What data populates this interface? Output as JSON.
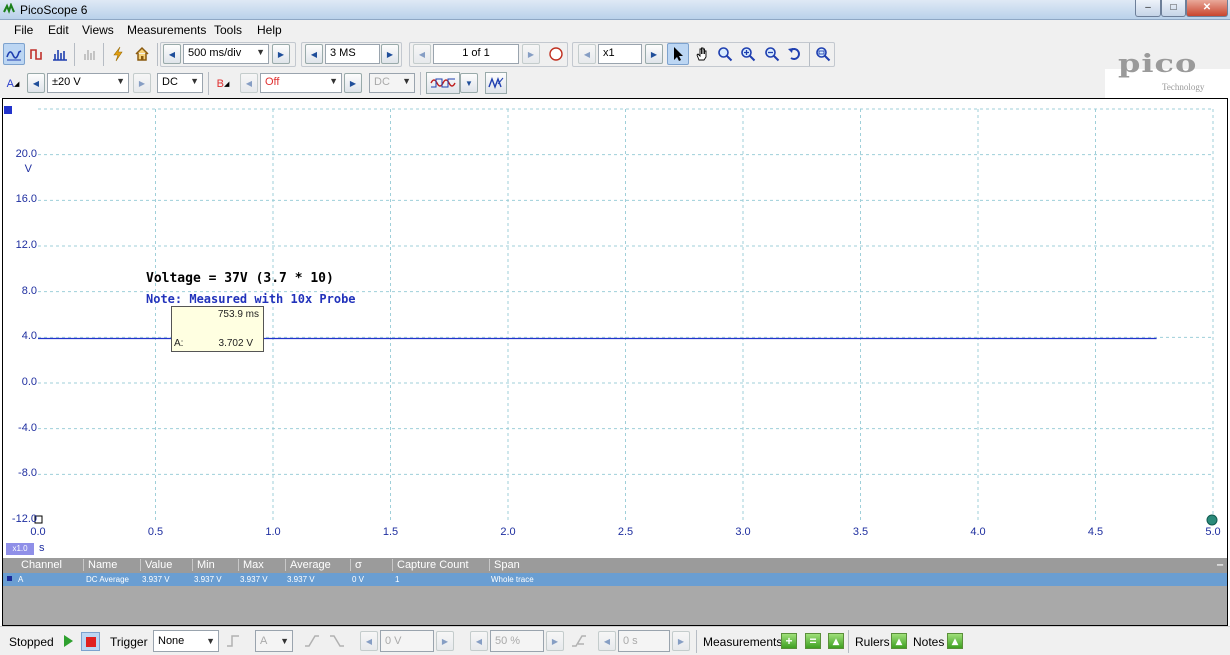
{
  "window": {
    "title": "PicoScope 6",
    "minimize": "‒",
    "maximize": "□",
    "close": "✕"
  },
  "menu": [
    "File",
    "Edit",
    "Views",
    "Measurements",
    "Tools",
    "Help"
  ],
  "toolbar1": {
    "timebase": "500 ms/div",
    "samples": "3 MS",
    "page": "1 of 1",
    "zoom": "x1"
  },
  "toolbar2": {
    "channel_a": {
      "label": "A",
      "range": "±20 V",
      "coupling": "DC",
      "color": "#2b3fcc"
    },
    "channel_b": {
      "label": "B",
      "range": "Off",
      "coupling": "DC",
      "color": "#e03030"
    }
  },
  "logo": {
    "text": "pico",
    "sub": "Technology"
  },
  "scope": {
    "y_unit": "V",
    "x_unit": "s",
    "x_zoom": "x1.0",
    "y_ticks": [
      "20.0",
      "16.0",
      "12.0",
      "8.0",
      "4.0",
      "0.0",
      "-4.0",
      "-8.0",
      "-12.0"
    ],
    "x_ticks": [
      "0.0",
      "0.5",
      "1.0",
      "1.5",
      "2.0",
      "2.5",
      "3.0",
      "3.5",
      "4.0",
      "4.5",
      "5.0"
    ],
    "trace_color": "#2233cc",
    "annotation_1": "Voltage = 37V (3.7 * 10)",
    "annotation_2": "Note: Measured with 10x Probe",
    "tooltip": {
      "time": "753.9 ms",
      "channel": "A:",
      "value": "3.702 V"
    }
  },
  "chart_data": {
    "type": "line",
    "series": [
      {
        "name": "A",
        "x": [
          0.0,
          4.76
        ],
        "y": [
          3.9,
          3.9
        ]
      }
    ],
    "xlabel": "s",
    "ylabel": "V",
    "xlim": [
      0.0,
      5.0
    ],
    "ylim": [
      -12.0,
      24.0
    ],
    "grid": true
  },
  "measurements": {
    "headers": [
      "Channel",
      "Name",
      "Value",
      "Min",
      "Max",
      "Average",
      "σ",
      "Capture Count",
      "Span"
    ],
    "rows": [
      [
        "A",
        "DC Average",
        "3.937 V",
        "3.937 V",
        "3.937 V",
        "3.937 V",
        "0 V",
        "1",
        "Whole trace"
      ]
    ],
    "collapse": "‒"
  },
  "status": {
    "state": "Stopped",
    "trigger_label": "Trigger",
    "trigger_mode": "None",
    "trigger_channel": "A",
    "trigger_level": "0 V",
    "trigger_pos": "50 %",
    "trigger_delay": "0 s",
    "measurements_label": "Measurements",
    "rulers_label": "Rulers",
    "notes_label": "Notes"
  }
}
